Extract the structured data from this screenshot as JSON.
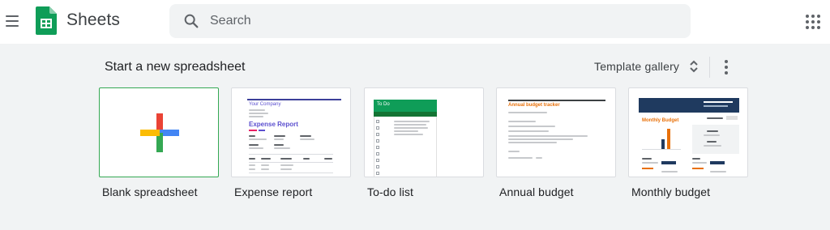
{
  "header": {
    "app_name": "Sheets",
    "search_placeholder": "Search"
  },
  "templates": {
    "section_title": "Start a new spreadsheet",
    "gallery_label": "Template gallery",
    "cards": [
      {
        "label": "Blank spreadsheet"
      },
      {
        "label": "Expense report",
        "thumb_title": "Expense Report",
        "thumb_company": "Your Company"
      },
      {
        "label": "To-do list",
        "thumb_title": "To Do"
      },
      {
        "label": "Annual budget",
        "thumb_title": "Annual budget tracker"
      },
      {
        "label": "Monthly budget",
        "thumb_title": "Monthly Budget"
      }
    ]
  },
  "colors": {
    "sheets_green": "#0f9d58",
    "section_bg": "#f1f3f4",
    "plus_red": "#ea4335",
    "plus_blue": "#4285f4",
    "plus_green": "#34a853",
    "plus_yellow": "#fbbc04"
  }
}
